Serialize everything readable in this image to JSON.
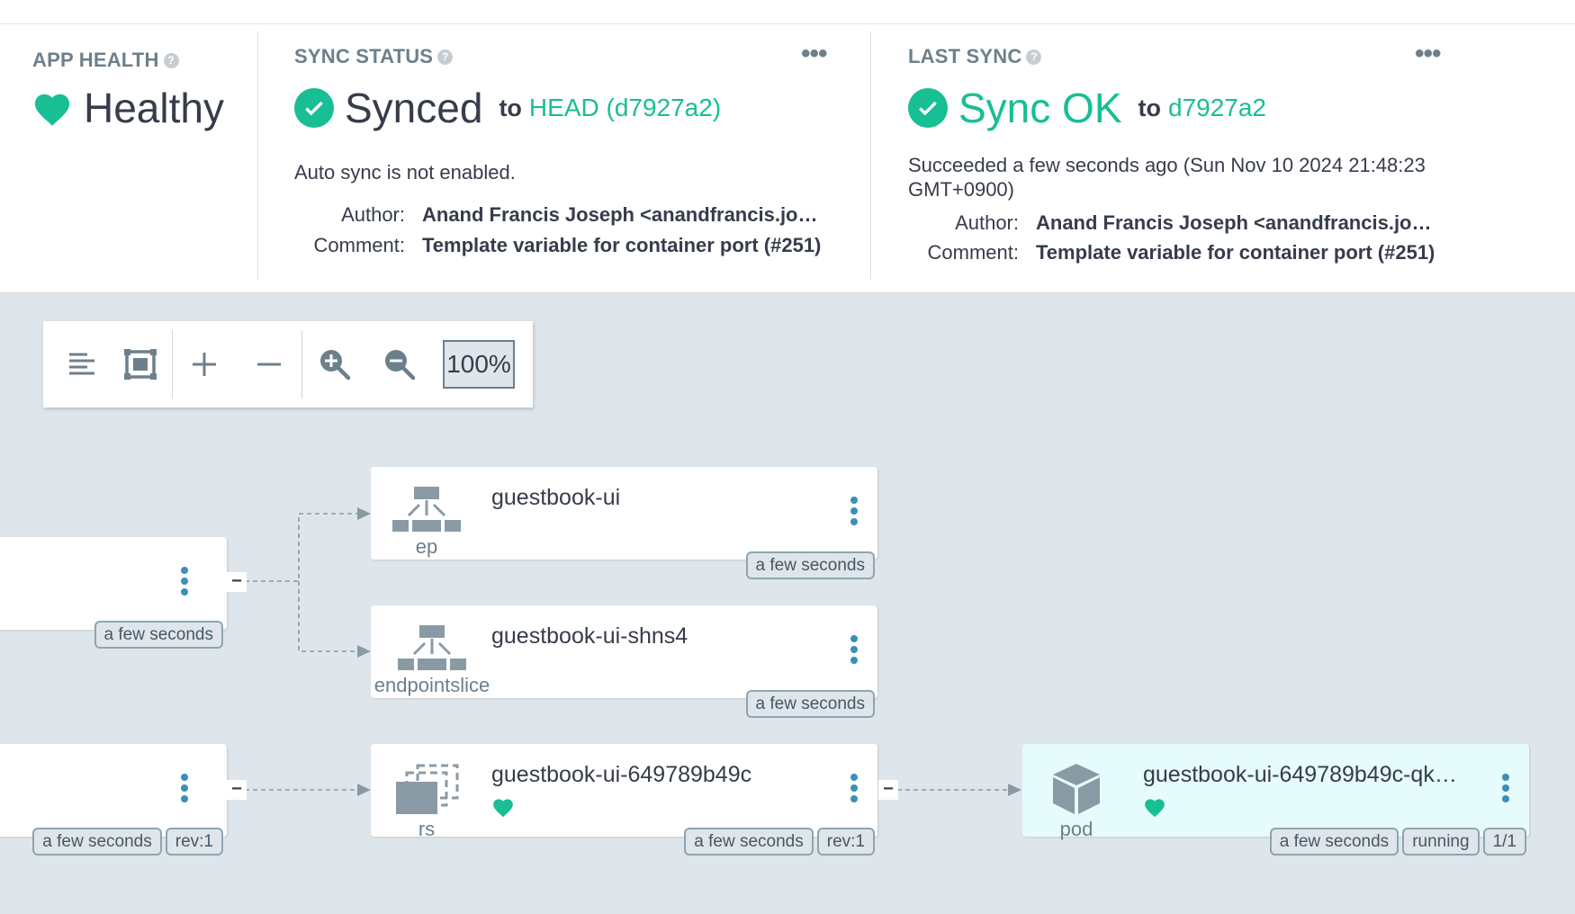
{
  "app_health": {
    "title": "APP HEALTH",
    "status": "Healthy",
    "color": "#18be94"
  },
  "sync_status": {
    "title": "SYNC STATUS",
    "status": "Synced",
    "to": "to",
    "revision": "HEAD (d7927a2)",
    "auto_sync": "Auto sync is not enabled.",
    "author_label": "Author:",
    "author": "Anand Francis Joseph <anandfrancis.josep…",
    "comment_label": "Comment:",
    "comment": "Template variable for container port (#251)",
    "more_icon": "more-horizontal-icon"
  },
  "last_sync": {
    "title": "LAST SYNC",
    "status": "Sync OK",
    "to": "to",
    "revision": "d7927a2",
    "succeeded_line1": "Succeeded a few seconds ago (Sun Nov 10 2024 21:48:23",
    "succeeded_line2": "GMT+0900)",
    "author_label": "Author:",
    "author": "Anand Francis Joseph <anandfrancis.josep…",
    "comment_label": "Comment:",
    "comment": "Template variable for container port (#251)",
    "more_icon": "more-horizontal-icon"
  },
  "toolbar": {
    "buttons": [
      "align-left-icon",
      "fit-screen-icon",
      "expand-all-icon",
      "collapse-all-icon",
      "zoom-in-icon",
      "zoom-out-icon"
    ],
    "zoom": "100%"
  },
  "nodes": {
    "svc_partial": {
      "tags": [
        "a few seconds"
      ]
    },
    "ep": {
      "name": "guestbook-ui",
      "kind": "ep",
      "tags": [
        "a few seconds"
      ]
    },
    "endpointslice": {
      "name": "guestbook-ui-shns4",
      "kind": "endpointslice",
      "tags": [
        "a few seconds"
      ]
    },
    "deploy_partial": {
      "tags": [
        "a few seconds",
        "rev:1"
      ]
    },
    "rs": {
      "name": "guestbook-ui-649789b49c",
      "kind": "rs",
      "tags": [
        "a few seconds",
        "rev:1"
      ],
      "health": "healthy"
    },
    "pod": {
      "name": "guestbook-ui-649789b49c-qk…",
      "kind": "pod",
      "tags": [
        "a few seconds",
        "running",
        "1/1"
      ],
      "health": "healthy"
    }
  },
  "colors": {
    "accent_green": "#18be94",
    "link_blue": "#3a8fb7",
    "muted": "#6d7f8b",
    "graph_bg": "#dee6eb"
  }
}
